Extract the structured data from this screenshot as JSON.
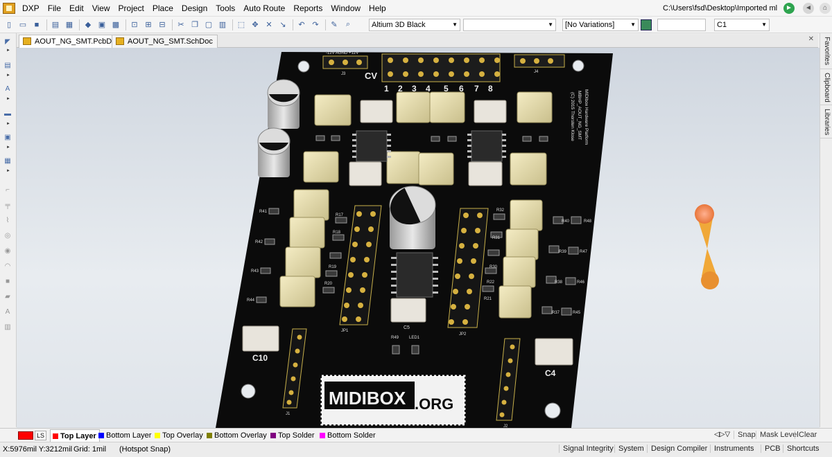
{
  "menubar": {
    "app": "DXP",
    "items": [
      "File",
      "Edit",
      "View",
      "Project",
      "Place",
      "Design",
      "Tools",
      "Auto Route",
      "Reports",
      "Window",
      "Help"
    ],
    "path": "C:\\Users\\fsd\\Desktop\\Imported ml"
  },
  "toolbar": {
    "view_config": "Altium 3D Black",
    "empty_combo": "",
    "variations": "[No Variations]",
    "empty_combo2": "",
    "component": "C1"
  },
  "tabs": [
    {
      "label": "AOUT_NG_SMT.PcbDoc *",
      "active": true
    },
    {
      "label": "AOUT_NG_SMT.SchDoc",
      "active": false
    }
  ],
  "right_dock": [
    "Favorites",
    "Clipboard",
    "Libraries"
  ],
  "layers": {
    "ls_label": "LS",
    "items": [
      {
        "label": "Top Layer",
        "color": "#ff0000",
        "active": true
      },
      {
        "label": "Bottom Layer",
        "color": "#0000ff",
        "active": false
      },
      {
        "label": "Top Overlay",
        "color": "#ffff00",
        "active": false
      },
      {
        "label": "Bottom Overlay",
        "color": "#808000",
        "active": false
      },
      {
        "label": "Top Solder",
        "color": "#800080",
        "active": false
      },
      {
        "label": "Bottom Solder",
        "color": "#ff00ff",
        "active": false
      }
    ],
    "right": [
      "Snap",
      "Mask Level",
      "Clear"
    ]
  },
  "status": {
    "coords": "X:5976mil Y:3212mil",
    "grid": "Grid: 1mil",
    "snap": "(Hotspot Snap)",
    "panels": [
      "Signal Integrity",
      "System",
      "Design Compiler",
      "Instruments",
      "PCB",
      "Shortcuts"
    ]
  },
  "board": {
    "logo_text": "MIDIBOX",
    "logo_suffix": ".ORG",
    "cv_label": "CV",
    "cv_numbers": [
      "1",
      "2",
      "3",
      "4",
      "5",
      "6",
      "7",
      "8"
    ],
    "side_text": [
      "MIDIbox Hardware Platform",
      "MBHP_AOUT_NG_SMT",
      "(C) 2015 Thorsten Klose"
    ],
    "labels": {
      "c10": "C10",
      "c4": "C4",
      "c5": "C5",
      "jp1": "JP1",
      "jp2": "JP2",
      "j1": "J1",
      "j2": "J2",
      "j3": "J3",
      "j4": "J4",
      "led1": "LED1",
      "r49": "R49",
      "header_top": "-12V AGND +12V"
    },
    "resistor_labels": [
      "R41",
      "R42",
      "R43",
      "R44",
      "R17",
      "R18",
      "R19",
      "R20",
      "R32",
      "R31",
      "R30",
      "R22",
      "R21",
      "R40",
      "R39",
      "R38",
      "R37",
      "R48",
      "R47",
      "R46",
      "R45"
    ]
  },
  "icons": {
    "menu": "app-logo-icon",
    "nav": [
      "forward-arrow-icon",
      "back-arrow-icon",
      "home-icon"
    ]
  }
}
